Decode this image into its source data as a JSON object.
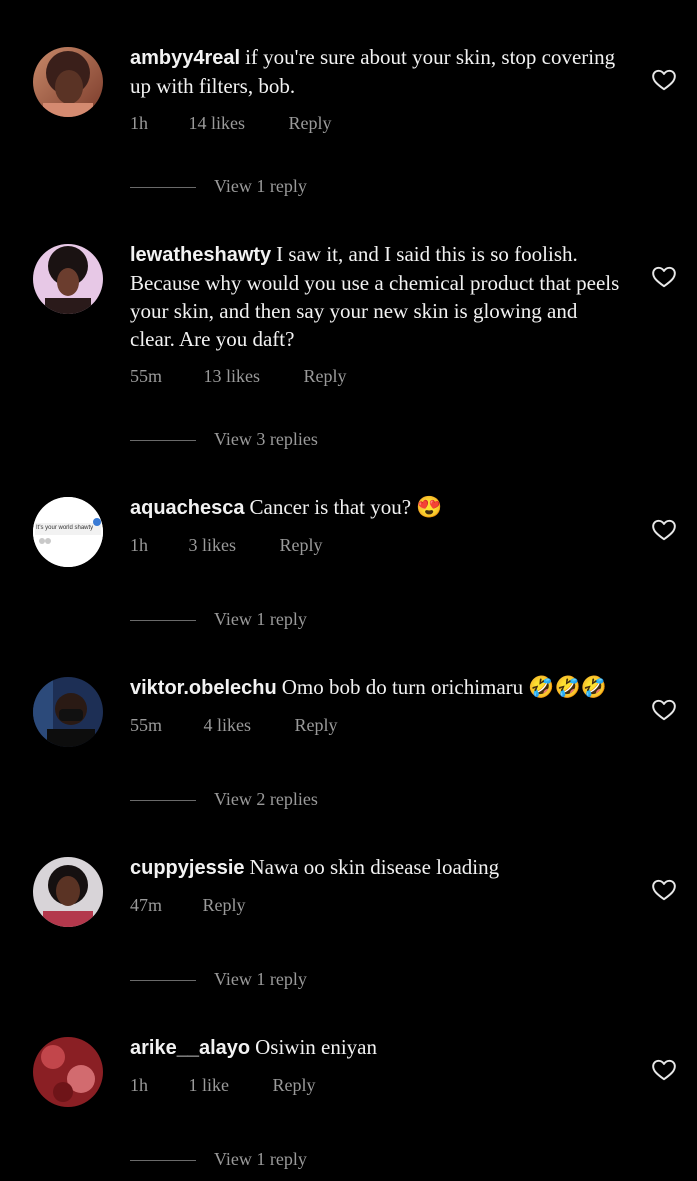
{
  "comments": [
    {
      "username": "ambyy4real",
      "text": "if you're sure about your skin, stop covering up with filters, bob.",
      "time": "1h",
      "likes": "14 likes",
      "reply_label": "Reply",
      "view_replies": "View 1 reply"
    },
    {
      "username": "lewatheshawty",
      "text": "I saw it, and I said this is so foolish. Because why would you use a chemical product that peels your skin, and then say your new skin is glowing and clear. Are you daft?",
      "time": "55m",
      "likes": "13 likes",
      "reply_label": "Reply",
      "view_replies": "View 3 replies"
    },
    {
      "username": "aquachesca",
      "text": "Cancer is that you? 😍",
      "time": "1h",
      "likes": "3 likes",
      "reply_label": "Reply",
      "view_replies": "View 1 reply",
      "avatar_text": "It's your world shawty"
    },
    {
      "username": "viktor.obelechu",
      "text": "Omo bob do turn orichimaru 🤣🤣🤣",
      "time": "55m",
      "likes": "4 likes",
      "reply_label": "Reply",
      "view_replies": "View 2 replies"
    },
    {
      "username": "cuppyjessie",
      "text": "Nawa oo skin disease loading",
      "time": "47m",
      "likes": "",
      "reply_label": "Reply",
      "view_replies": "View 1 reply"
    },
    {
      "username": "arike__alayo",
      "text": "Osiwin eniyan",
      "time": "1h",
      "likes": "1 like",
      "reply_label": "Reply",
      "view_replies": "View 1 reply"
    }
  ],
  "icons": {
    "like": "heart-outline-icon"
  },
  "colors": {
    "background": "#000000",
    "text": "#f2f2f2",
    "muted": "#9a9a9a"
  }
}
